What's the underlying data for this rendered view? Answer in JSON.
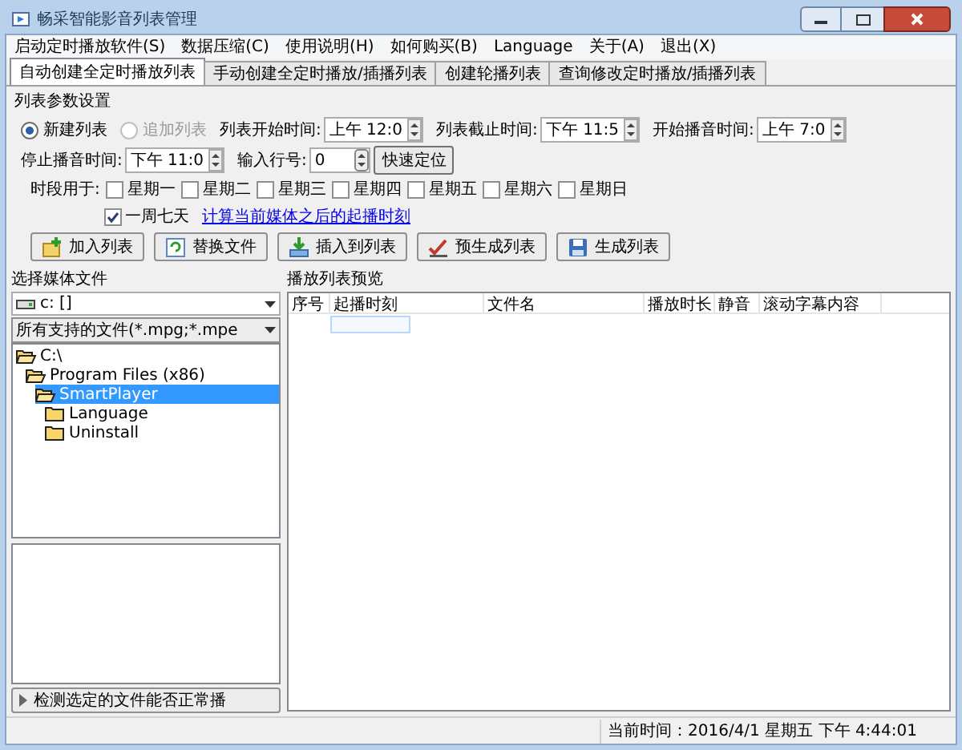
{
  "window": {
    "title": "畅采智能影音列表管理"
  },
  "menu": [
    "启动定时播放软件(S)",
    "数据压缩(C)",
    "使用说明(H)",
    "如何购买(B)",
    "Language",
    "关于(A)",
    "退出(X)"
  ],
  "tabs": [
    {
      "label": "自动创建全定时播放列表",
      "selected": true
    },
    {
      "label": "手动创建全定时播放/插播列表",
      "selected": false
    },
    {
      "label": "创建轮播列表",
      "selected": false
    },
    {
      "label": "查询修改定时播放/插播列表",
      "selected": false
    }
  ],
  "params": {
    "title": "列表参数设置",
    "modes": [
      {
        "label": "新建列表",
        "selected": true,
        "disabled": false
      },
      {
        "label": "追加列表",
        "selected": false,
        "disabled": true
      }
    ],
    "times": [
      {
        "label": "列表开始时间:",
        "value": "上午 12:0"
      },
      {
        "label": "列表截止时间:",
        "value": "下午 11:5"
      },
      {
        "label": "开始播音时间:",
        "value": "上午 7:0"
      },
      {
        "label": "停止播音时间:",
        "value": "下午 11:0"
      }
    ],
    "row_number": {
      "label": "输入行号:",
      "value": "0"
    },
    "locate_button": "快速定位",
    "days_label": "时段用于:",
    "days": [
      {
        "label": "星期一",
        "checked": false
      },
      {
        "label": "星期二",
        "checked": false
      },
      {
        "label": "星期三",
        "checked": false
      },
      {
        "label": "星期四",
        "checked": false
      },
      {
        "label": "星期五",
        "checked": false
      },
      {
        "label": "星期六",
        "checked": false
      },
      {
        "label": "星期日",
        "checked": false
      }
    ],
    "week": {
      "label": "一周七天",
      "checked": true
    },
    "link": "计算当前媒体之后的起播时刻",
    "actions": [
      {
        "label": "加入列表",
        "kind": "add"
      },
      {
        "label": "替换文件",
        "kind": "replace"
      },
      {
        "label": "插入到列表",
        "kind": "insert"
      },
      {
        "label": "预生成列表",
        "kind": "pregenerate"
      },
      {
        "label": "生成列表",
        "kind": "generate"
      }
    ]
  },
  "media": {
    "title": "选择媒体文件",
    "drive": "c: []",
    "filter": "所有支持的文件(*.mpg;*.mpe",
    "tree": [
      {
        "label": "C:\\",
        "expanded": true,
        "selected": false,
        "children": [
          {
            "label": "Program Files (x86)",
            "expanded": true,
            "selected": false,
            "children": [
              {
                "label": "SmartPlayer",
                "expanded": true,
                "selected": true,
                "children": [
                  {
                    "label": "Language",
                    "expanded": false,
                    "selected": false
                  },
                  {
                    "label": "Uninstall",
                    "expanded": false,
                    "selected": false
                  }
                ]
              }
            ]
          }
        ]
      }
    ],
    "check_button": "检测选定的文件能否正常播"
  },
  "playlist": {
    "title": "播放列表预览",
    "columns": [
      "序号",
      "起播时刻",
      "文件名",
      "播放时长",
      "静音",
      "滚动字幕内容"
    ]
  },
  "status_bar": {
    "time": "当前时间：2016/4/1 星期五 下午 4:44:01"
  }
}
